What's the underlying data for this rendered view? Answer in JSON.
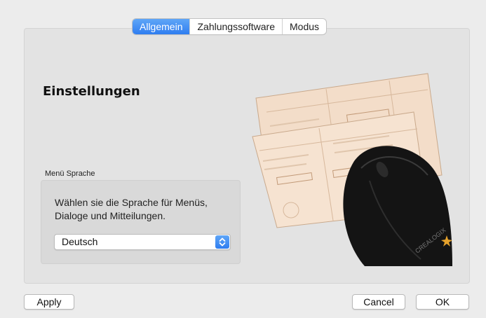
{
  "tabs": [
    "Allgemein",
    "Zahlungssoftware",
    "Modus"
  ],
  "active_tab": "Allgemein",
  "main": {
    "title": "Einstellungen",
    "language_group": {
      "label": "Menü Sprache",
      "description": "Wählen sie die Sprache für Menüs, Dialoge und Mitteilungen.",
      "selected": "Deutsch"
    },
    "illustration": {
      "brand": "CREALOGIX"
    }
  },
  "buttons": {
    "apply": "Apply",
    "cancel": "Cancel",
    "ok": "OK"
  },
  "colors": {
    "accent": "#2f7df0",
    "panel": "#e3e3e3",
    "window": "#ececec"
  }
}
